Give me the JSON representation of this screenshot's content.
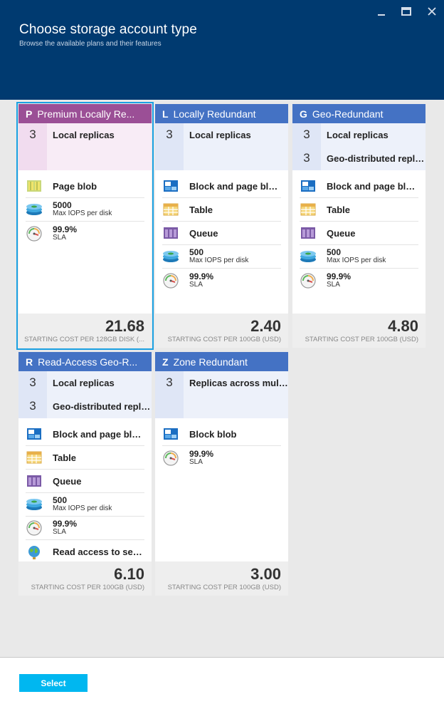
{
  "window": {
    "title": "Choose storage account type",
    "subtitle": "Browse the available plans and their features"
  },
  "colors": {
    "header_bg": "#003a70",
    "premium": "#9b4f96",
    "standard": "#4472c4",
    "select_button": "#00b7f0",
    "selection_outline": "#1ba1e2"
  },
  "plans": [
    {
      "letter": "P",
      "name": "Premium Locally Re...",
      "selected": true,
      "replicas": [
        {
          "count": "3",
          "label": "Local replicas"
        },
        {
          "count": "",
          "label": ""
        }
      ],
      "features": [
        {
          "icon": "page-blob-icon",
          "label": "Page blob"
        },
        {
          "icon": "iops-disk-icon",
          "value": "5000",
          "sub": "Max IOPS per disk"
        },
        {
          "icon": "sla-gauge-icon",
          "value": "99.9%",
          "sub": "SLA"
        }
      ],
      "price": "21.68",
      "price_note": "STARTING COST PER 128GB DISK (..."
    },
    {
      "letter": "L",
      "name": "Locally Redundant",
      "selected": false,
      "replicas": [
        {
          "count": "3",
          "label": "Local replicas"
        },
        {
          "count": "",
          "label": ""
        }
      ],
      "features": [
        {
          "icon": "block-page-blob-icon",
          "label": "Block and page blobs"
        },
        {
          "icon": "table-icon",
          "label": "Table"
        },
        {
          "icon": "queue-icon",
          "label": "Queue"
        },
        {
          "icon": "iops-disk-icon",
          "value": "500",
          "sub": "Max IOPS per disk"
        },
        {
          "icon": "sla-gauge-icon",
          "value": "99.9%",
          "sub": "SLA"
        }
      ],
      "price": "2.40",
      "price_note": "STARTING COST PER 100GB (USD)"
    },
    {
      "letter": "G",
      "name": "Geo-Redundant",
      "selected": false,
      "replicas": [
        {
          "count": "3",
          "label": "Local replicas"
        },
        {
          "count": "3",
          "label": "Geo-distributed replic..."
        }
      ],
      "features": [
        {
          "icon": "block-page-blob-icon",
          "label": "Block and page blobs"
        },
        {
          "icon": "table-icon",
          "label": "Table"
        },
        {
          "icon": "queue-icon",
          "label": "Queue"
        },
        {
          "icon": "iops-disk-icon",
          "value": "500",
          "sub": "Max IOPS per disk"
        },
        {
          "icon": "sla-gauge-icon",
          "value": "99.9%",
          "sub": "SLA"
        }
      ],
      "price": "4.80",
      "price_note": "STARTING COST PER 100GB (USD)"
    },
    {
      "letter": "R",
      "name": "Read-Access Geo-R...",
      "selected": false,
      "replicas": [
        {
          "count": "3",
          "label": "Local replicas"
        },
        {
          "count": "3",
          "label": "Geo-distributed replic..."
        }
      ],
      "features": [
        {
          "icon": "block-page-blob-icon",
          "label": "Block and page blobs"
        },
        {
          "icon": "table-icon",
          "label": "Table"
        },
        {
          "icon": "queue-icon",
          "label": "Queue"
        },
        {
          "icon": "iops-disk-icon",
          "value": "500",
          "sub": "Max IOPS per disk"
        },
        {
          "icon": "sla-gauge-icon",
          "value": "99.9%",
          "sub": "SLA"
        },
        {
          "icon": "globe-icon",
          "label": "Read access to seco..."
        }
      ],
      "price": "6.10",
      "price_note": "STARTING COST PER 100GB (USD)"
    },
    {
      "letter": "Z",
      "name": "Zone Redundant",
      "selected": false,
      "replicas": [
        {
          "count": "3",
          "label": "Replicas across multip..."
        },
        {
          "count": "",
          "label": ""
        }
      ],
      "features": [
        {
          "icon": "block-blob-icon",
          "label": "Block blob"
        },
        {
          "icon": "sla-gauge-icon",
          "value": "99.9%",
          "sub": "SLA"
        }
      ],
      "price": "3.00",
      "price_note": "STARTING COST PER 100GB (USD)"
    }
  ],
  "footer": {
    "select_label": "Select"
  }
}
